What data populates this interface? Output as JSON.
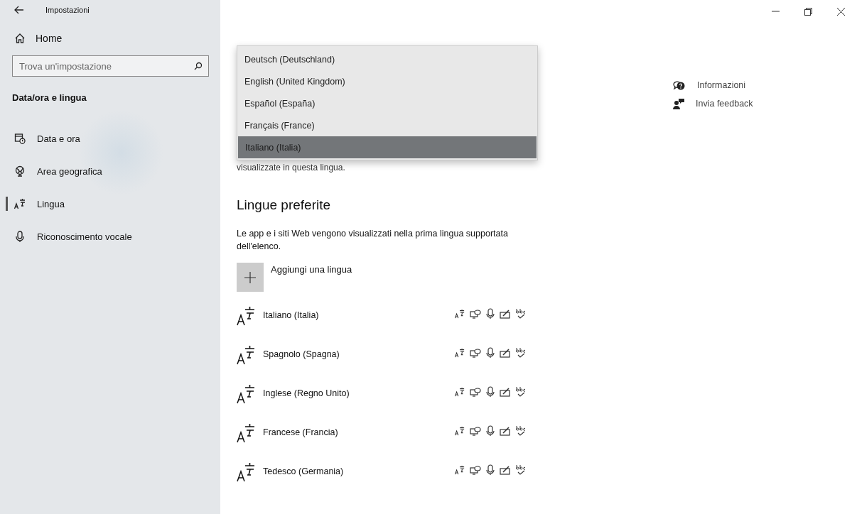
{
  "window": {
    "title": "Impostazioni"
  },
  "sidebar": {
    "home": "Home",
    "search": {
      "placeholder": "Trova un'impostazione"
    },
    "section": "Data/ora e lingua",
    "items": [
      {
        "label": "Data e ora",
        "selected": false
      },
      {
        "label": "Area geografica",
        "selected": false
      },
      {
        "label": "Lingua",
        "selected": true
      },
      {
        "label": "Riconoscimento vocale",
        "selected": false
      }
    ]
  },
  "dropdown": {
    "options": [
      {
        "label": "Deutsch (Deutschland)",
        "selected": false
      },
      {
        "label": "English (United Kingdom)",
        "selected": false
      },
      {
        "label": "Español (España)",
        "selected": false
      },
      {
        "label": "Français (France)",
        "selected": false
      },
      {
        "label": "Italiano (Italia)",
        "selected": true
      }
    ]
  },
  "display_language_note": "visualizzate in questa lingua.",
  "preferred": {
    "title": "Lingue preferite",
    "description": "Le app e i siti Web vengono visualizzati nella prima lingua supportata dell'elenco.",
    "add_label": "Aggiungi una lingua",
    "languages": [
      {
        "name": "Italiano (Italia)"
      },
      {
        "name": "Spagnolo (Spagna)"
      },
      {
        "name": "Inglese (Regno Unito)"
      },
      {
        "name": "Francese (Francia)"
      },
      {
        "name": "Tedesco (Germania)"
      }
    ]
  },
  "links": [
    {
      "label": "Informazioni"
    },
    {
      "label": "Invia feedback"
    }
  ]
}
